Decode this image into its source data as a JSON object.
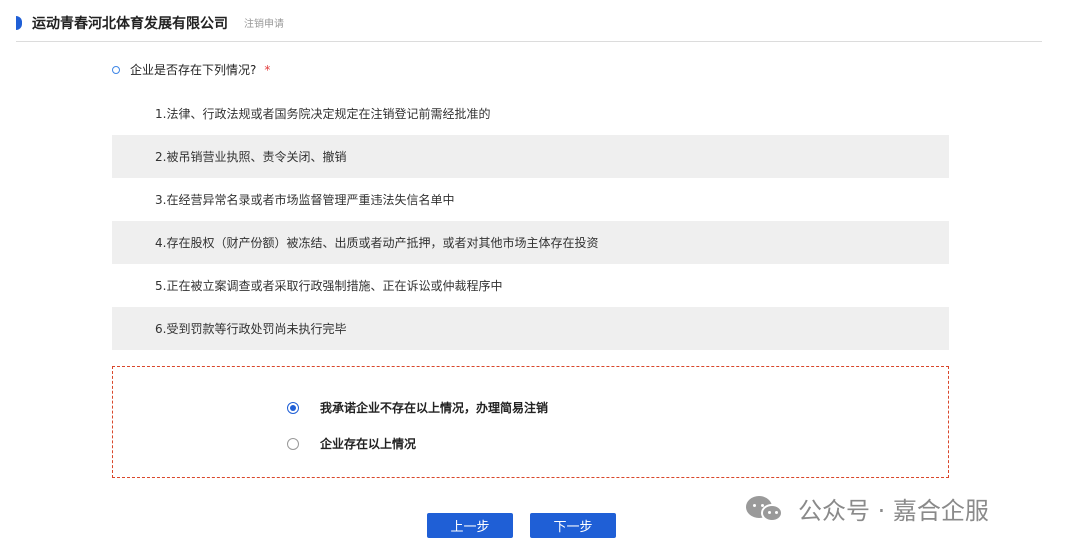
{
  "header": {
    "company": "运动青春河北体育发展有限公司",
    "subtitle": "注销申请"
  },
  "question": {
    "text": "企业是否存在下列情况?",
    "required": "*"
  },
  "conditions": [
    "1.法律、行政法规或者国务院决定规定在注销登记前需经批准的",
    "2.被吊销营业执照、责令关闭、撤销",
    "3.在经营异常名录或者市场监督管理严重违法失信名单中",
    "4.存在股权（财产份额）被冻结、出质或者动产抵押，或者对其他市场主体存在投资",
    "5.正在被立案调查或者采取行政强制措施、正在诉讼或仲裁程序中",
    "6.受到罚款等行政处罚尚未执行完毕"
  ],
  "options": [
    {
      "label": "我承诺企业不存在以上情况，办理简易注销",
      "selected": true
    },
    {
      "label": "企业存在以上情况",
      "selected": false
    }
  ],
  "buttons": {
    "prev": "上一步",
    "next": "下一步"
  },
  "watermark": {
    "text": "公众号 · 嘉合企服",
    "icon": "wechat-icon"
  },
  "colors": {
    "accent": "#1f5fd6",
    "required": "#e23c3c",
    "dashed_border": "#d9472b",
    "row_alt_bg": "#efefef"
  }
}
